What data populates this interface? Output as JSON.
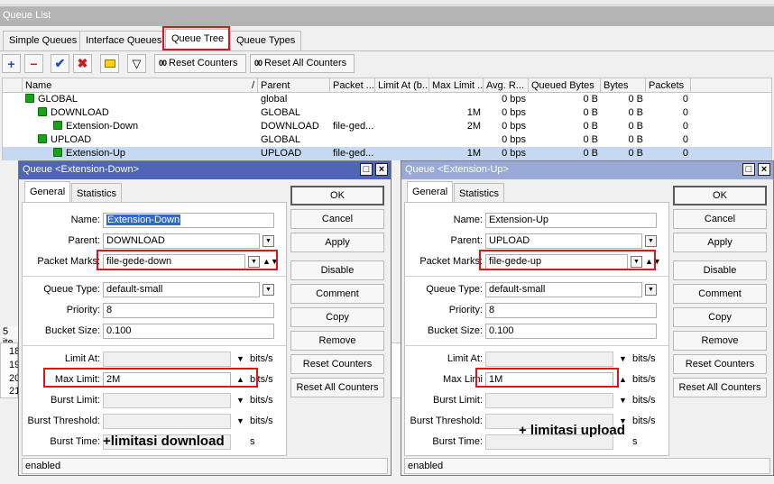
{
  "list_window": {
    "title": "Queue List"
  },
  "tabs": [
    {
      "label": "Simple Queues"
    },
    {
      "label": "Interface Queues"
    },
    {
      "label": "Queue Tree"
    },
    {
      "label": "Queue Types"
    }
  ],
  "toolbar": {
    "reset_counters": "Reset Counters",
    "reset_all_counters": "Reset All Counters",
    "icon_text": "00"
  },
  "table": {
    "headers": [
      "Name",
      "Parent",
      "Packet ...",
      "Limit At (b...",
      "Max Limit ...",
      "Avg. R...",
      "Queued Bytes",
      "Bytes",
      "Packets"
    ],
    "rows": [
      {
        "name": "GLOBAL",
        "parent": "global",
        "packet": "",
        "limit_at": "",
        "max_limit": "",
        "avg": "0 bps",
        "queued": "0 B",
        "bytes": "0 B",
        "packets": "0"
      },
      {
        "name": "DOWNLOAD",
        "parent": "GLOBAL",
        "packet": "",
        "limit_at": "",
        "max_limit": "1M",
        "avg": "0 bps",
        "queued": "0 B",
        "bytes": "0 B",
        "packets": "0"
      },
      {
        "name": "Extension-Down",
        "parent": "DOWNLOAD",
        "packet": "file-ged...",
        "limit_at": "",
        "max_limit": "2M",
        "avg": "0 bps",
        "queued": "0 B",
        "bytes": "0 B",
        "packets": "0"
      },
      {
        "name": "UPLOAD",
        "parent": "GLOBAL",
        "packet": "",
        "limit_at": "",
        "max_limit": "",
        "avg": "0 bps",
        "queued": "0 B",
        "bytes": "0 B",
        "packets": "0"
      },
      {
        "name": "Extension-Up",
        "parent": "UPLOAD",
        "packet": "file-ged...",
        "limit_at": "",
        "max_limit": "1M",
        "avg": "0 bps",
        "queued": "0 B",
        "bytes": "0 B",
        "packets": "0"
      }
    ],
    "items_status": "5 ite",
    "lower_rows": [
      "18",
      "19",
      "20",
      "21"
    ]
  },
  "dialog_labels": {
    "tab_general": "General",
    "tab_statistics": "Statistics",
    "name": "Name:",
    "parent": "Parent:",
    "packet_marks": "Packet Marks:",
    "queue_type": "Queue Type:",
    "priority": "Priority:",
    "bucket_size": "Bucket Size:",
    "limit_at": "Limit At:",
    "max_limit": "Max Limit:",
    "burst_limit": "Burst Limit:",
    "burst_threshold": "Burst Threshold:",
    "burst_time": "Burst Time:",
    "unit_bits": "bits/s",
    "unit_s": "s",
    "ok": "OK",
    "cancel": "Cancel",
    "apply": "Apply",
    "disable": "Disable",
    "comment": "Comment",
    "copy": "Copy",
    "remove": "Remove",
    "reset_counters": "Reset Counters",
    "reset_all_counters": "Reset All Counters",
    "status": "enabled"
  },
  "dialog_down": {
    "title": "Queue <Extension-Down>",
    "name": "Extension-Down",
    "parent": "DOWNLOAD",
    "packet_marks": "file-gede-down",
    "queue_type": "default-small",
    "priority": "8",
    "bucket_size": "0.100",
    "limit_at": "",
    "max_limit": "2M",
    "burst_limit": "",
    "burst_threshold": "",
    "burst_time": "",
    "max_limit_label": "Max Limit:",
    "annotation": "+limitasi download"
  },
  "dialog_up": {
    "title": "Queue <Extension-Up>",
    "name": "Extension-Up",
    "parent": "UPLOAD",
    "packet_marks": "file-gede-up",
    "queue_type": "default-small",
    "priority": "8",
    "bucket_size": "0.100",
    "limit_at": "",
    "max_limit": "1M",
    "burst_limit": "",
    "burst_threshold": "",
    "burst_time": "",
    "max_limit_label": "Max Limi",
    "annotation": "+ limitasi upload"
  },
  "colors": {
    "title_active": "#5065b8",
    "title_inactive": "#9aaad6",
    "highlight": "#e0131a",
    "queue_icon": "#19a319",
    "row_selected": "#c7d9f2"
  }
}
